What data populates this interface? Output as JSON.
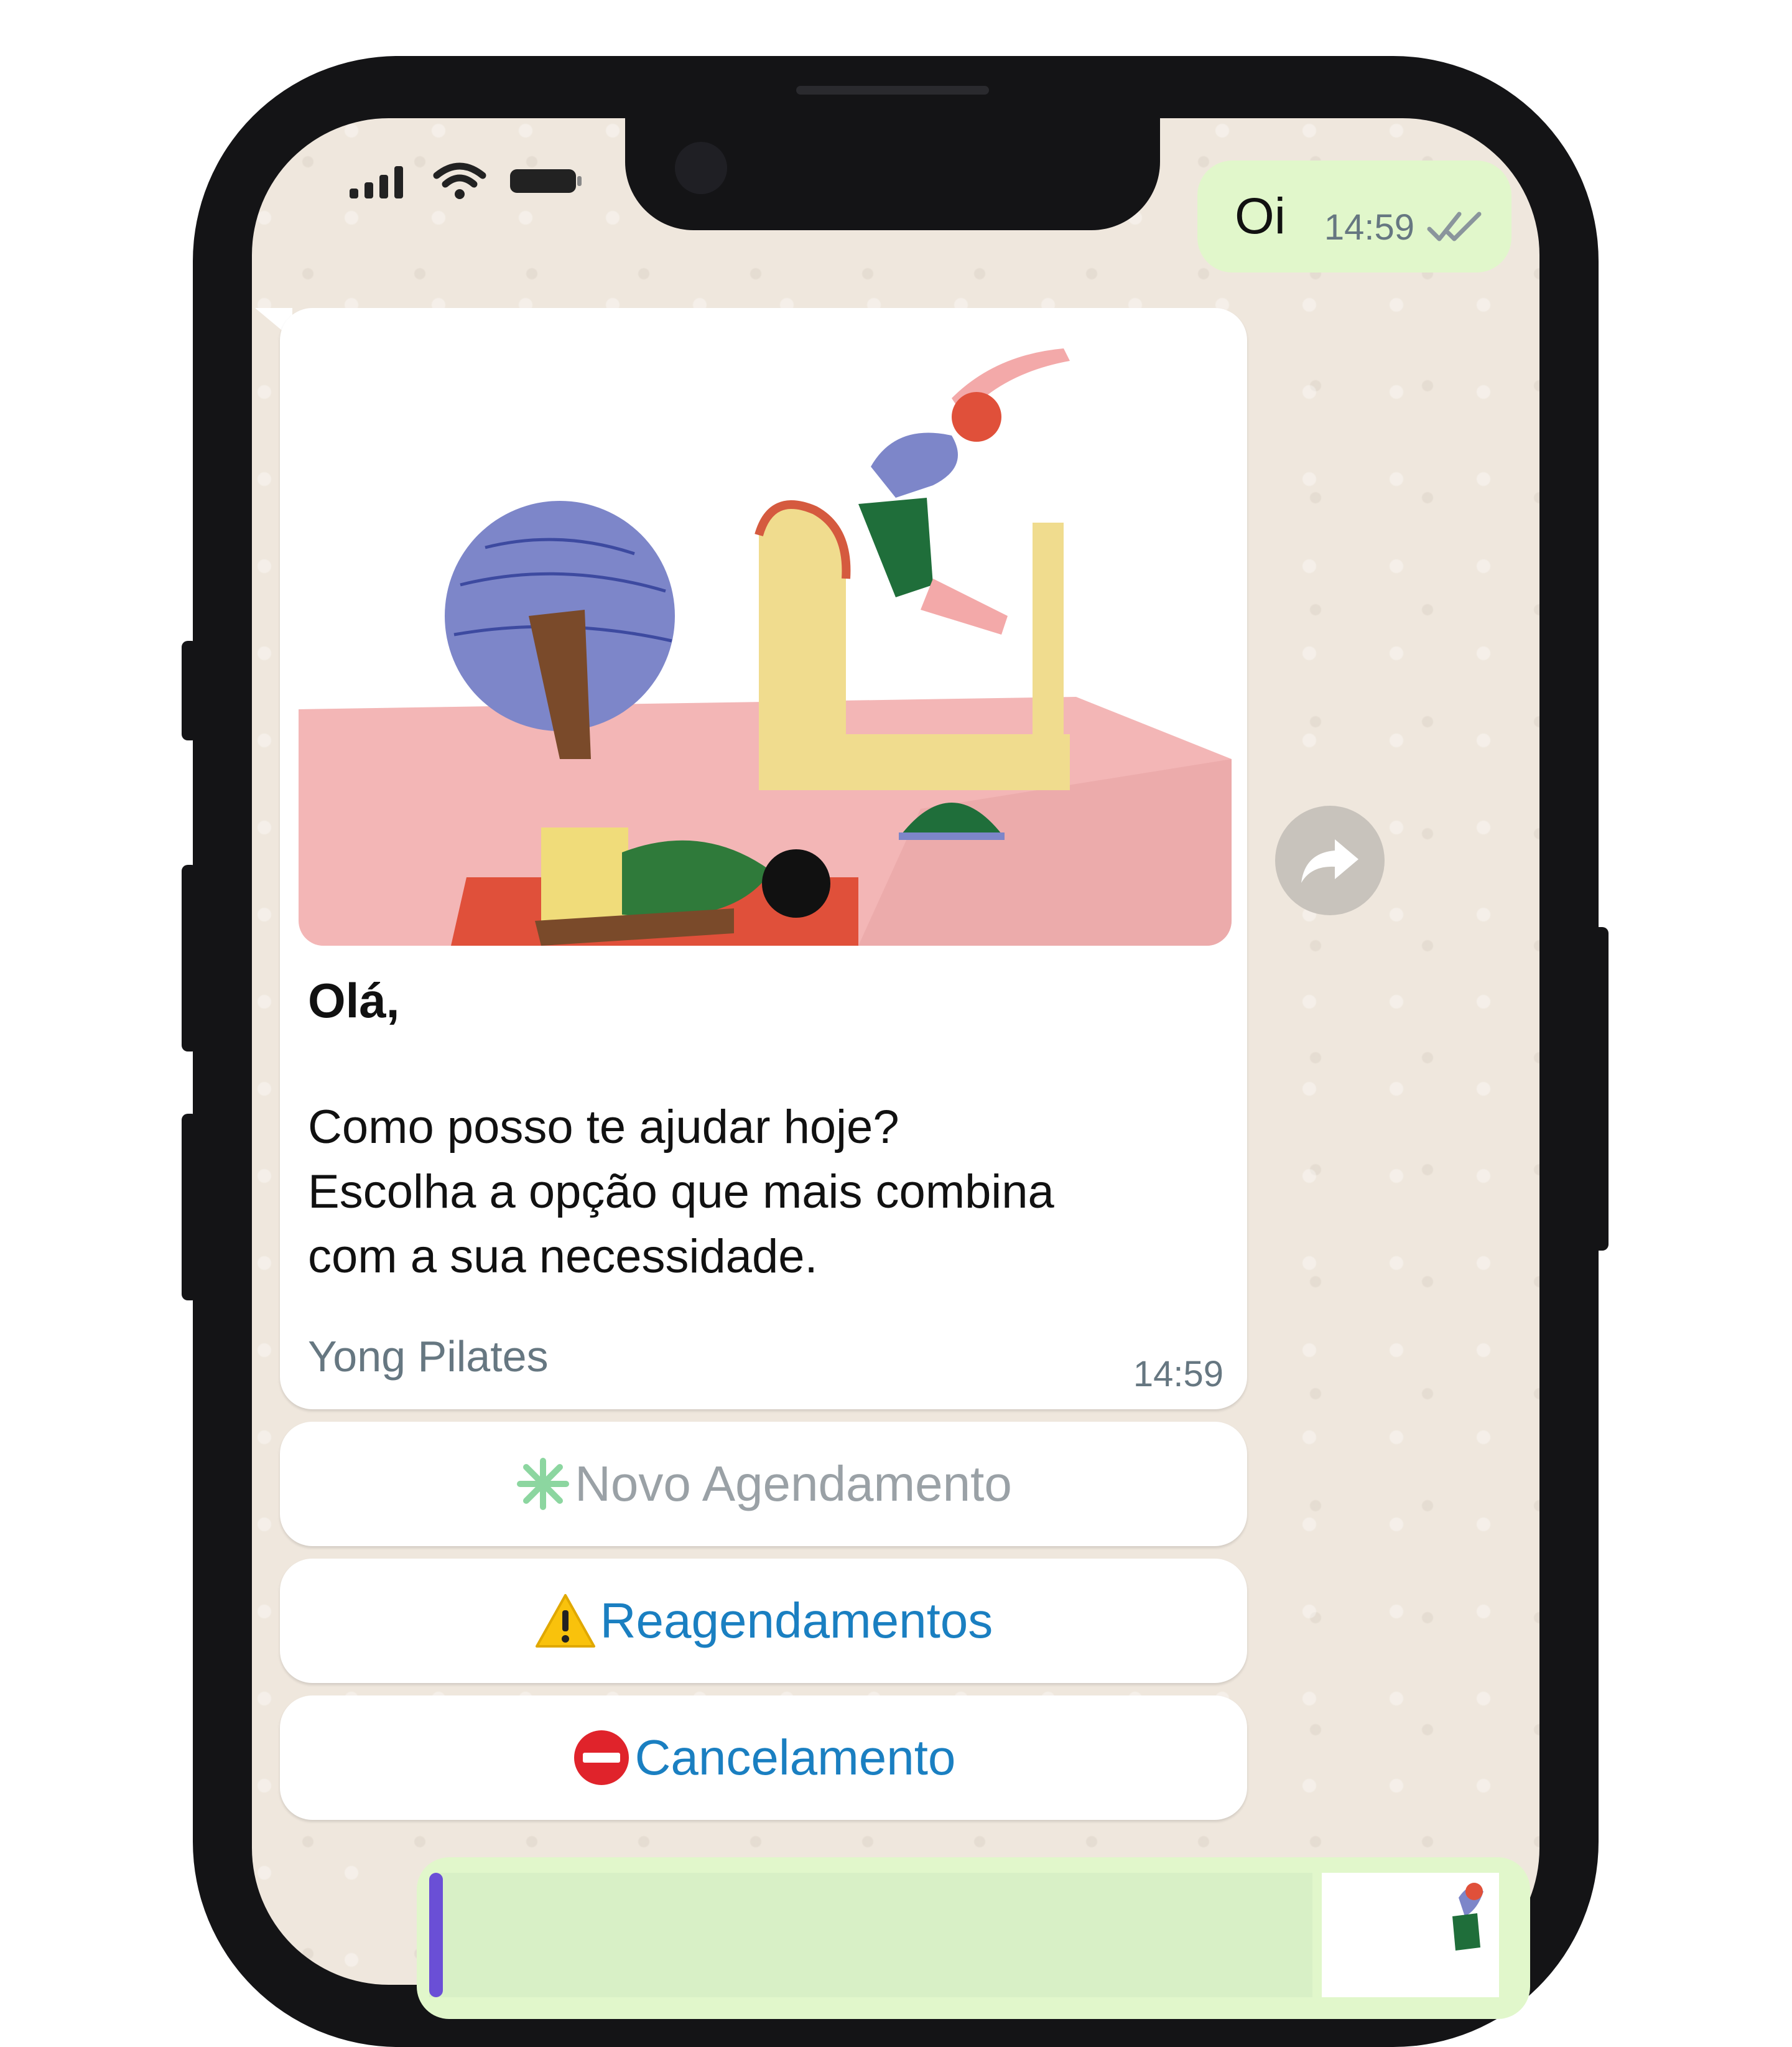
{
  "chat": {
    "outgoing": {
      "text": "Oi",
      "time": "14:59",
      "status_icon": "double-check-icon"
    },
    "incoming": {
      "image_alt": "pilates-illustration",
      "greeting": "Olá,",
      "body": "Como posso te ajudar hoje?\nEscolha a opção que mais combina\ncom a sua necessidade.",
      "footer": "Yong Pilates",
      "time": "14:59"
    },
    "quick_replies": [
      {
        "icon": "asterisk-icon",
        "label": "Novo Agendamento",
        "color": "#9aa1a6"
      },
      {
        "icon": "warning-icon",
        "label": "Reagendamentos",
        "color": "#1a7fc1"
      },
      {
        "icon": "no-entry-icon",
        "label": "Cancelamento",
        "color": "#1a7fc1"
      }
    ],
    "forward_icon": "forward-icon"
  },
  "colors": {
    "chat_background": "#efe7dd",
    "outgoing_bubble": "#e1f7cb",
    "incoming_bubble": "#ffffff",
    "link_blue": "#1a7fc1"
  }
}
